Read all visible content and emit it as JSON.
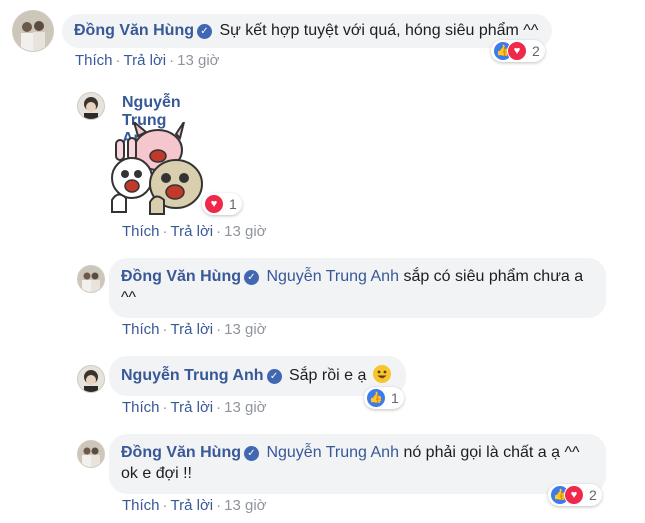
{
  "comments": [
    {
      "author": "Đồng Văn Hùng",
      "text": "Sự kết hợp tuyệt với quá, hóng siêu phẩm ^^",
      "reaction_count": "2"
    },
    {
      "author": "Nguyễn Trung Anh",
      "reaction_count": "1"
    },
    {
      "author": "Đồng Văn Hùng",
      "mention": "Nguyễn Trung Anh",
      "text_line1": "sắp có siêu phẩm chưa a",
      "text_line2": "^^"
    },
    {
      "author": "Nguyễn Trung Anh",
      "text": "Sắp rồi e ạ",
      "reaction_count": "1"
    },
    {
      "author": "Đồng Văn Hùng",
      "mention": "Nguyễn Trung Anh",
      "text_line1": "nó phải gọi là chất a ạ ^^",
      "text_line2": "ok e đợi !!",
      "reaction_count": "2"
    }
  ],
  "actions": {
    "like": "Thích",
    "reply": "Trả lời",
    "time": "13 giờ",
    "dot": "·"
  },
  "colors": {
    "link": "#385898",
    "bubble": "#f2f3f5",
    "muted": "#90949c",
    "like": "#3b7bf0",
    "love": "#f0284a"
  }
}
